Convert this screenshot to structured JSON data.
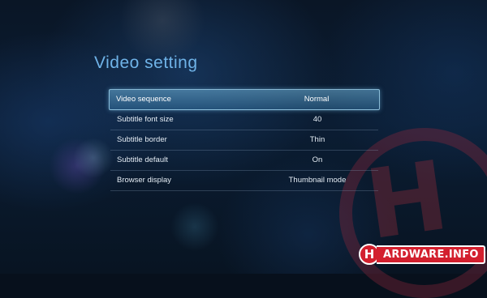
{
  "screen": {
    "title": "Video setting"
  },
  "menu": {
    "items": [
      {
        "label": "Video sequence",
        "value": "Normal"
      },
      {
        "label": "Subtitle font size",
        "value": "40"
      },
      {
        "label": "Subtitle border",
        "value": "Thin"
      },
      {
        "label": "Subtitle default",
        "value": "On"
      },
      {
        "label": "Browser display",
        "value": "Thumbnail mode"
      }
    ],
    "selected_index": 0
  },
  "watermark": {
    "letter": "H",
    "logo_letter": "H",
    "logo_text": "ARDWARE.INFO"
  },
  "colors": {
    "title": "#6fb3e8",
    "selection": "#6eb4dc",
    "brand_red": "#d3202e"
  }
}
